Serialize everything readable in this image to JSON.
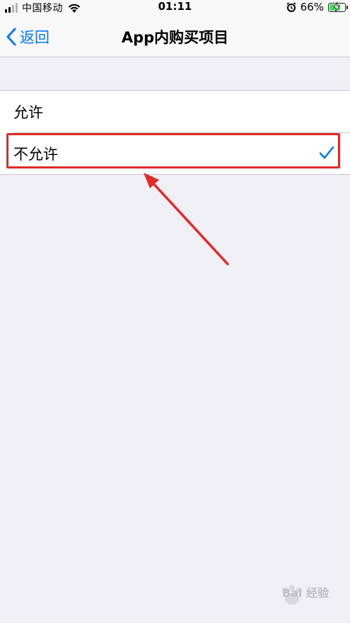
{
  "status_bar": {
    "carrier": "中国移动",
    "time": "01:11",
    "battery_percent": "66%",
    "battery_level": 0.66,
    "icons": [
      "signal-icon",
      "wifi-icon",
      "alarm-icon",
      "battery-icon"
    ]
  },
  "nav": {
    "back_label": "返回",
    "title": "App内购买项目"
  },
  "options": [
    {
      "label": "允许",
      "selected": false
    },
    {
      "label": "不允许",
      "selected": true
    }
  ],
  "annotation": {
    "highlight_color": "#e02a2a",
    "arrow_color": "#e02a2a"
  },
  "colors": {
    "accent": "#007aff",
    "background": "#efeff4",
    "battery_fill": "#4cd964"
  },
  "watermark": {
    "text": "Bai 经验"
  }
}
